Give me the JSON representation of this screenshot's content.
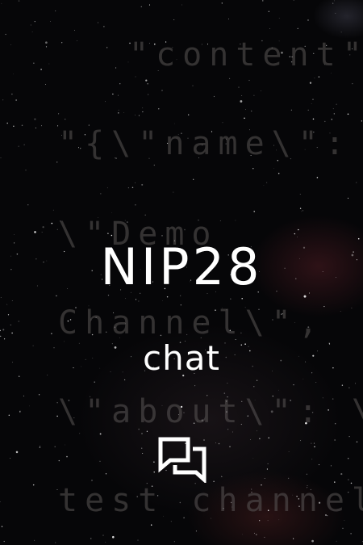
{
  "background": {
    "code_lines": [
      "\"content\"",
      "\"{\\\"name\\\":",
      "\\\"Demo",
      "Channel\\\",",
      "\\\"about\\\": \\\"A",
      "test channel"
    ]
  },
  "title": "NIP28",
  "subtitle": "chat",
  "icon": "chat-bubbles-icon",
  "colors": {
    "background": "#060608",
    "text": "#ffffff",
    "code_text": "#5a5656"
  }
}
